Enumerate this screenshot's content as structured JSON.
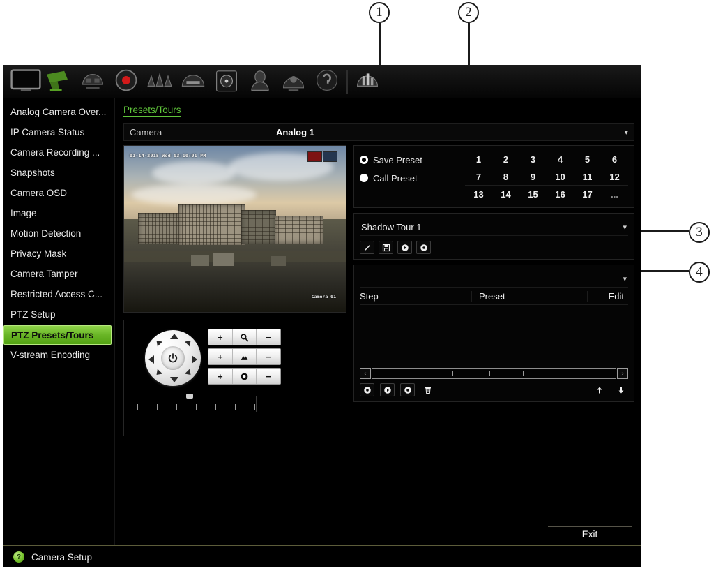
{
  "callouts": [
    {
      "num": "1"
    },
    {
      "num": "2"
    },
    {
      "num": "3"
    },
    {
      "num": "4"
    }
  ],
  "toolbar": {
    "icons": [
      {
        "name": "monitor-icon"
      },
      {
        "name": "camera-icon"
      },
      {
        "name": "network-icon"
      },
      {
        "name": "record-icon"
      },
      {
        "name": "alarm-icon"
      },
      {
        "name": "storage-array-icon"
      },
      {
        "name": "hard-disk-icon"
      },
      {
        "name": "user-icon"
      },
      {
        "name": "system-settings-icon"
      },
      {
        "name": "help-icon"
      },
      {
        "name": "shutdown-icon"
      }
    ]
  },
  "sidebar": {
    "items": [
      {
        "label": "Analog Camera Over...",
        "selected": false
      },
      {
        "label": "IP Camera Status",
        "selected": false
      },
      {
        "label": "Camera Recording ...",
        "selected": false
      },
      {
        "label": "Snapshots",
        "selected": false
      },
      {
        "label": "Camera OSD",
        "selected": false
      },
      {
        "label": "Image",
        "selected": false
      },
      {
        "label": "Motion Detection",
        "selected": false
      },
      {
        "label": "Privacy Mask",
        "selected": false
      },
      {
        "label": "Camera Tamper",
        "selected": false
      },
      {
        "label": "Restricted Access C...",
        "selected": false
      },
      {
        "label": "PTZ Setup",
        "selected": false
      },
      {
        "label": "PTZ Presets/Tours",
        "selected": true
      },
      {
        "label": "V-stream Encoding",
        "selected": false
      }
    ]
  },
  "content": {
    "page_title": "Presets/Tours",
    "camera_field": {
      "label": "Camera",
      "value": "Analog 1"
    }
  },
  "video": {
    "osd_timestamp": "01-14-2015 Wed 03:10:01 PM",
    "camera_label": "Camera 01"
  },
  "ptz": {
    "dpad_name": "ptz-direction-pad",
    "center_button": "auto-scan-button",
    "controls": [
      {
        "name": "zoom",
        "icon": "magnifier-icon",
        "plus": "+",
        "minus": "−"
      },
      {
        "name": "focus",
        "icon": "focus-icon",
        "plus": "+",
        "minus": "−"
      },
      {
        "name": "iris",
        "icon": "iris-icon",
        "plus": "+",
        "minus": "−"
      }
    ],
    "speed_label": ""
  },
  "presets": {
    "save_preset_label": "Save Preset",
    "call_preset_label": "Call Preset",
    "save_selected": true,
    "call_selected": false,
    "grid_rows": [
      [
        "1",
        "2",
        "3",
        "4",
        "5",
        "6"
      ],
      [
        "7",
        "8",
        "9",
        "10",
        "11",
        "12"
      ],
      [
        "13",
        "14",
        "15",
        "16",
        "17",
        "..."
      ]
    ]
  },
  "tour": {
    "selected_tour": "Shadow Tour 1",
    "buttons": [
      {
        "name": "edit-tour-button",
        "icon": "pencil-icon"
      },
      {
        "name": "save-tour-button",
        "icon": "floppy-icon"
      },
      {
        "name": "play-tour-button",
        "icon": "play-icon"
      },
      {
        "name": "record-tour-button",
        "icon": "record-icon"
      }
    ]
  },
  "steps": {
    "tour_select_value": "",
    "columns": [
      "Step",
      "Preset",
      "Edit"
    ],
    "rows": [],
    "scroll_left": "‹",
    "scroll_right": "›",
    "toolbar_buttons": [
      {
        "name": "add-step-button",
        "icon": "record-icon"
      },
      {
        "name": "play-step-button",
        "icon": "play-icon"
      },
      {
        "name": "stop-step-button",
        "icon": "record-icon"
      },
      {
        "name": "delete-step-button",
        "icon": "trash-icon"
      }
    ],
    "move_buttons": [
      {
        "name": "move-up-button",
        "icon": "arrow-up-icon"
      },
      {
        "name": "move-down-button",
        "icon": "arrow-down-icon"
      }
    ]
  },
  "footer": {
    "exit_label": "Exit"
  },
  "statusbar": {
    "help_icon": "help-icon",
    "text": "Camera Setup"
  },
  "colors": {
    "accent_green": "#5fc33a",
    "selected_green": "#69b526",
    "panel_black": "#000000",
    "text_light": "#ededed"
  }
}
